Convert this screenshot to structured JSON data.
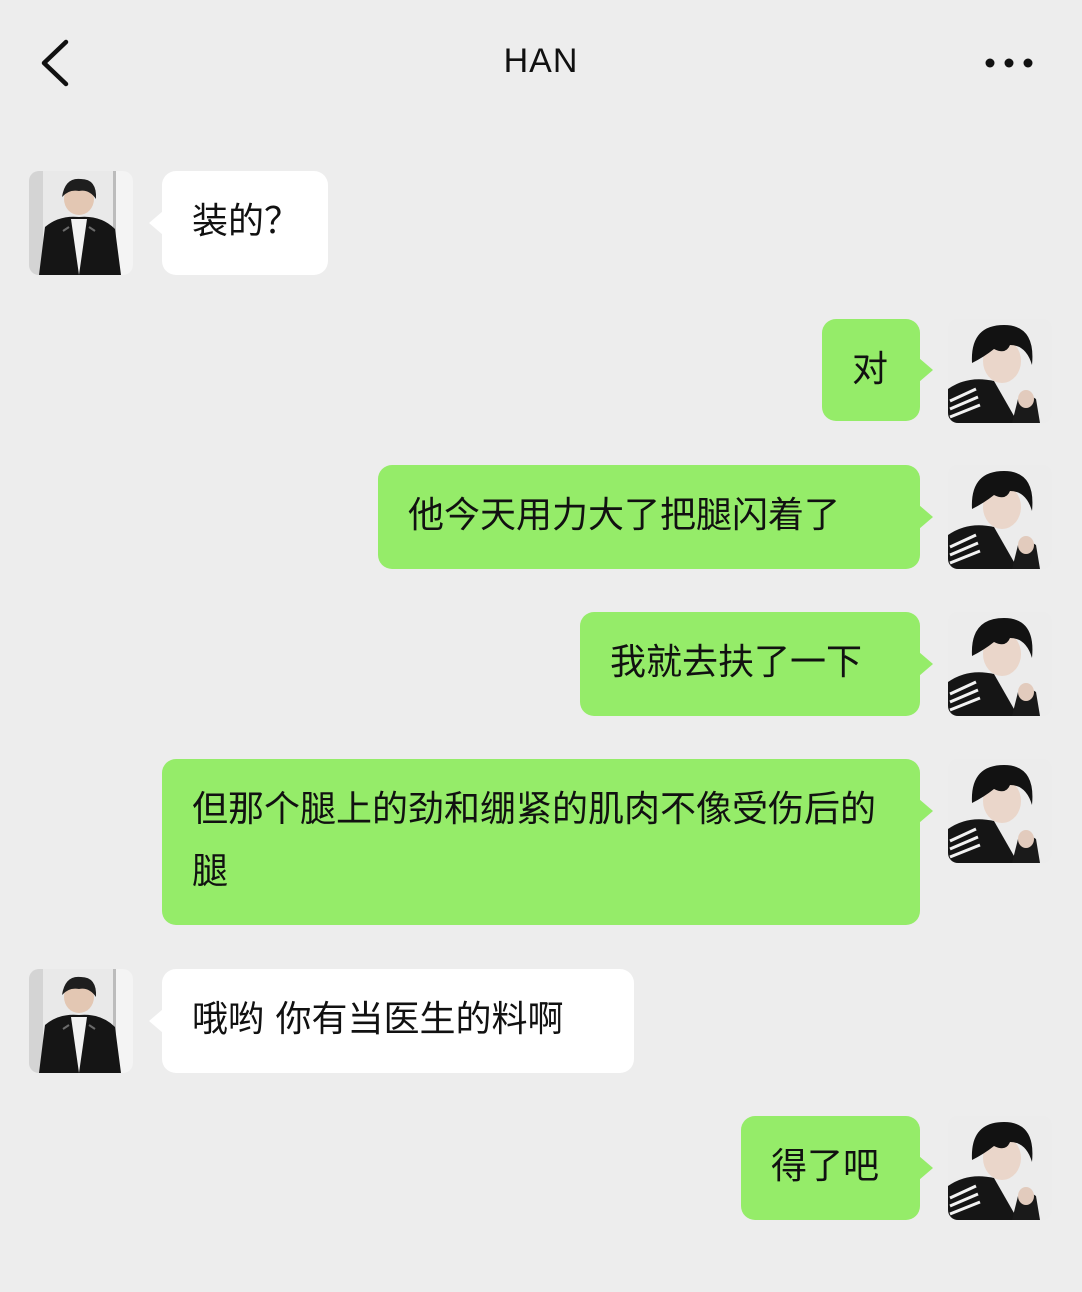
{
  "header": {
    "title": "HAN",
    "back_icon": "chevron-left-icon",
    "more_icon": "more-dots-icon"
  },
  "colors": {
    "background": "#ededed",
    "incoming_bubble": "#ffffff",
    "outgoing_bubble": "#95ec69"
  },
  "messages": [
    {
      "side": "incoming",
      "text": "装的？"
    },
    {
      "side": "outgoing",
      "text": "对"
    },
    {
      "side": "outgoing",
      "text": "他今天用力大了把腿闪着了"
    },
    {
      "side": "outgoing",
      "text": "我就去扶了一下"
    },
    {
      "side": "outgoing",
      "text": "但那个腿上的劲和绷紧的肌肉不像受伤后的腿"
    },
    {
      "side": "incoming",
      "text": "哦哟 你有当医生的料啊"
    },
    {
      "side": "outgoing",
      "text": "得了吧"
    }
  ]
}
